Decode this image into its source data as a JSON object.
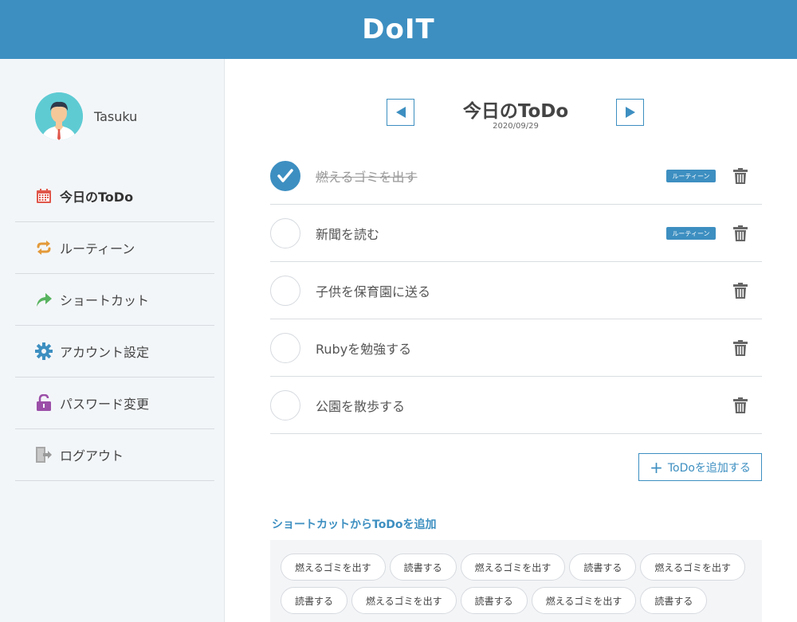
{
  "header": {
    "logo": "DoIT"
  },
  "user": {
    "name": "Tasuku"
  },
  "nav": [
    {
      "label": "今日のToDo",
      "icon": "calendar-icon",
      "active": true,
      "color": "#e0574b"
    },
    {
      "label": "ルーティーン",
      "icon": "repeat-icon",
      "active": false,
      "color": "#e39a3a"
    },
    {
      "label": "ショートカット",
      "icon": "share-arrow-icon",
      "active": false,
      "color": "#58b35f"
    },
    {
      "label": "アカウント設定",
      "icon": "gear-icon",
      "active": false,
      "color": "#3d8fc1"
    },
    {
      "label": "パスワード変更",
      "icon": "unlock-icon",
      "active": false,
      "color": "#9b4fa8"
    },
    {
      "label": "ログアウト",
      "icon": "logout-icon",
      "active": false,
      "color": "#9a9a9a"
    }
  ],
  "main": {
    "title": "今日のToDo",
    "date": "2020/09/29",
    "todos": [
      {
        "text": "燃えるゴミを出す",
        "done": true,
        "badge": "ルーティーン"
      },
      {
        "text": "新聞を読む",
        "done": false,
        "badge": "ルーティーン"
      },
      {
        "text": "子供を保育園に送る",
        "done": false,
        "badge": ""
      },
      {
        "text": "Rubyを勉強する",
        "done": false,
        "badge": ""
      },
      {
        "text": "公園を散歩する",
        "done": false,
        "badge": ""
      }
    ],
    "add_button": "ToDoを追加する",
    "add_icon": "+",
    "shortcut_heading": "ショートカットからToDoを追加",
    "shortcuts": [
      "燃えるゴミを出す",
      "読書する",
      "燃えるゴミを出す",
      "読書する",
      "燃えるゴミを出す",
      "読書する",
      "燃えるゴミを出す",
      "読書する",
      "燃えるゴミを出す",
      "読書する"
    ]
  },
  "colors": {
    "primary": "#3d8fc1",
    "sidebar_bg": "#f3f6f9"
  }
}
